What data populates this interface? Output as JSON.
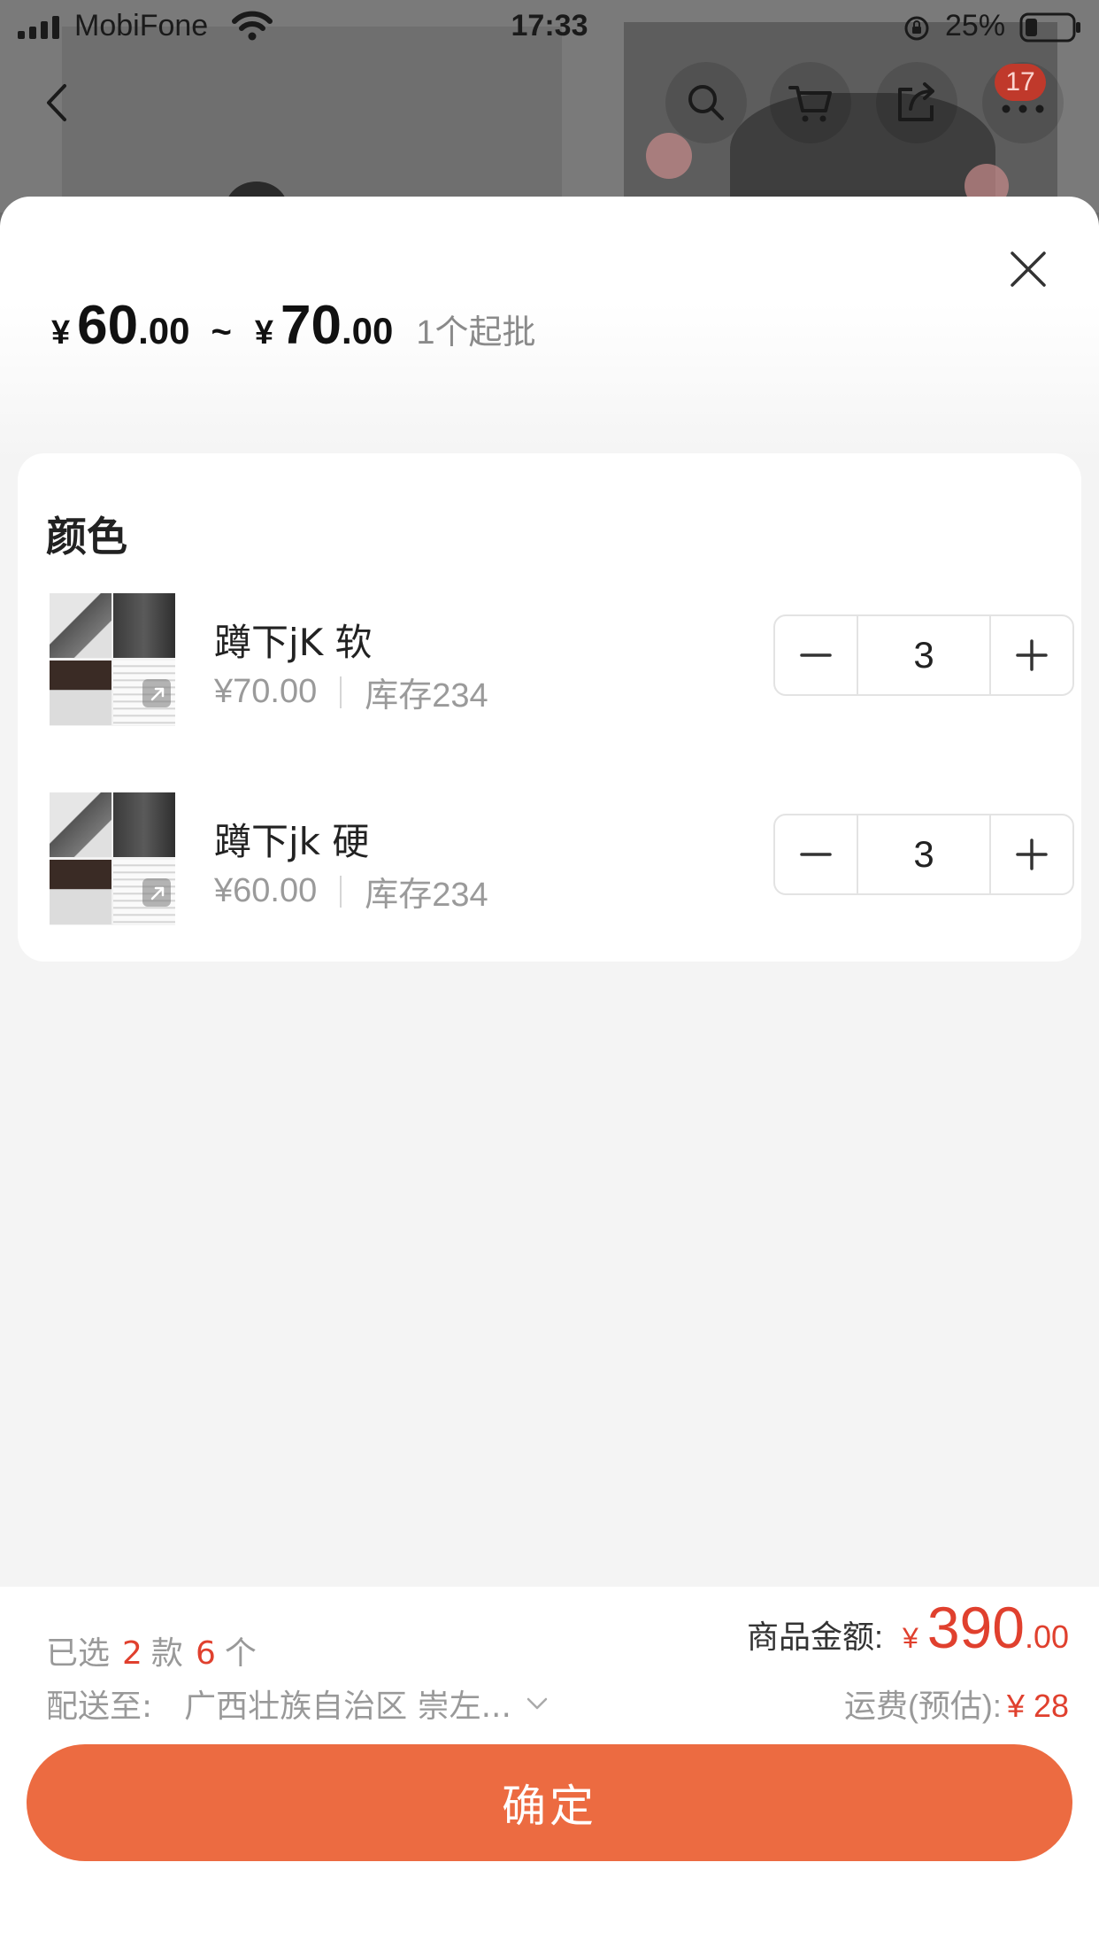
{
  "status_bar": {
    "carrier": "MobiFone",
    "time": "17:33",
    "battery": "25%"
  },
  "background": {
    "cart_badge": "17"
  },
  "sheet": {
    "price": {
      "yen": "¥",
      "min_int": "60",
      "min_dec": ".00",
      "separator": "~",
      "max_int": "70",
      "max_dec": ".00",
      "moq": "1个起批"
    },
    "section_title": "颜色",
    "variants": [
      {
        "name": "蹲下jK 软",
        "price": "¥70.00",
        "stock": "库存234",
        "qty": "3"
      },
      {
        "name": "蹲下jk 硬",
        "price": "¥60.00",
        "stock": "库存234",
        "qty": "3"
      }
    ]
  },
  "footer": {
    "selected_prefix": "已选",
    "selected_styles": "2",
    "styles_unit": "款",
    "selected_count": "6",
    "count_unit": "个",
    "amount_label": "商品金额:",
    "amount_yen": "¥",
    "amount_int": "390",
    "amount_dec": ".00",
    "ship_label": "配送至:",
    "ship_address": "广西壮族自治区 崇左...",
    "fee_label": "运费(预估):",
    "fee_value": "¥ 28",
    "confirm_label": "确定"
  },
  "colors": {
    "accent": "#ec6b41",
    "price_red": "#e0402e"
  }
}
